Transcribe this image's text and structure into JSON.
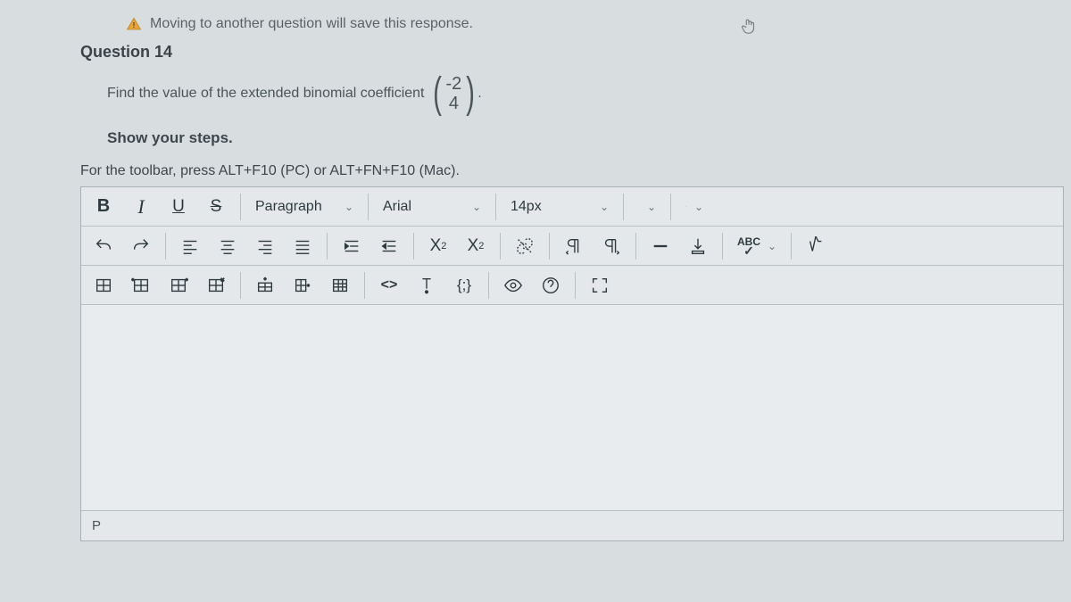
{
  "warning": {
    "text": "Moving to another question will save this response."
  },
  "question": {
    "label": "Question 14",
    "prompt": "Find the value of the extended binomial coefficient",
    "binom_top": "-2",
    "binom_bottom": "4",
    "period": ".",
    "show_steps": "Show your steps."
  },
  "toolbar_hint": "For the toolbar, press ALT+F10 (PC) or ALT+FN+F10 (Mac).",
  "format": {
    "bold": "B",
    "italic": "I",
    "underline": "U",
    "strike": "S",
    "block": "Paragraph",
    "font": "Arial",
    "size": "14px"
  },
  "status": {
    "path": "P"
  }
}
